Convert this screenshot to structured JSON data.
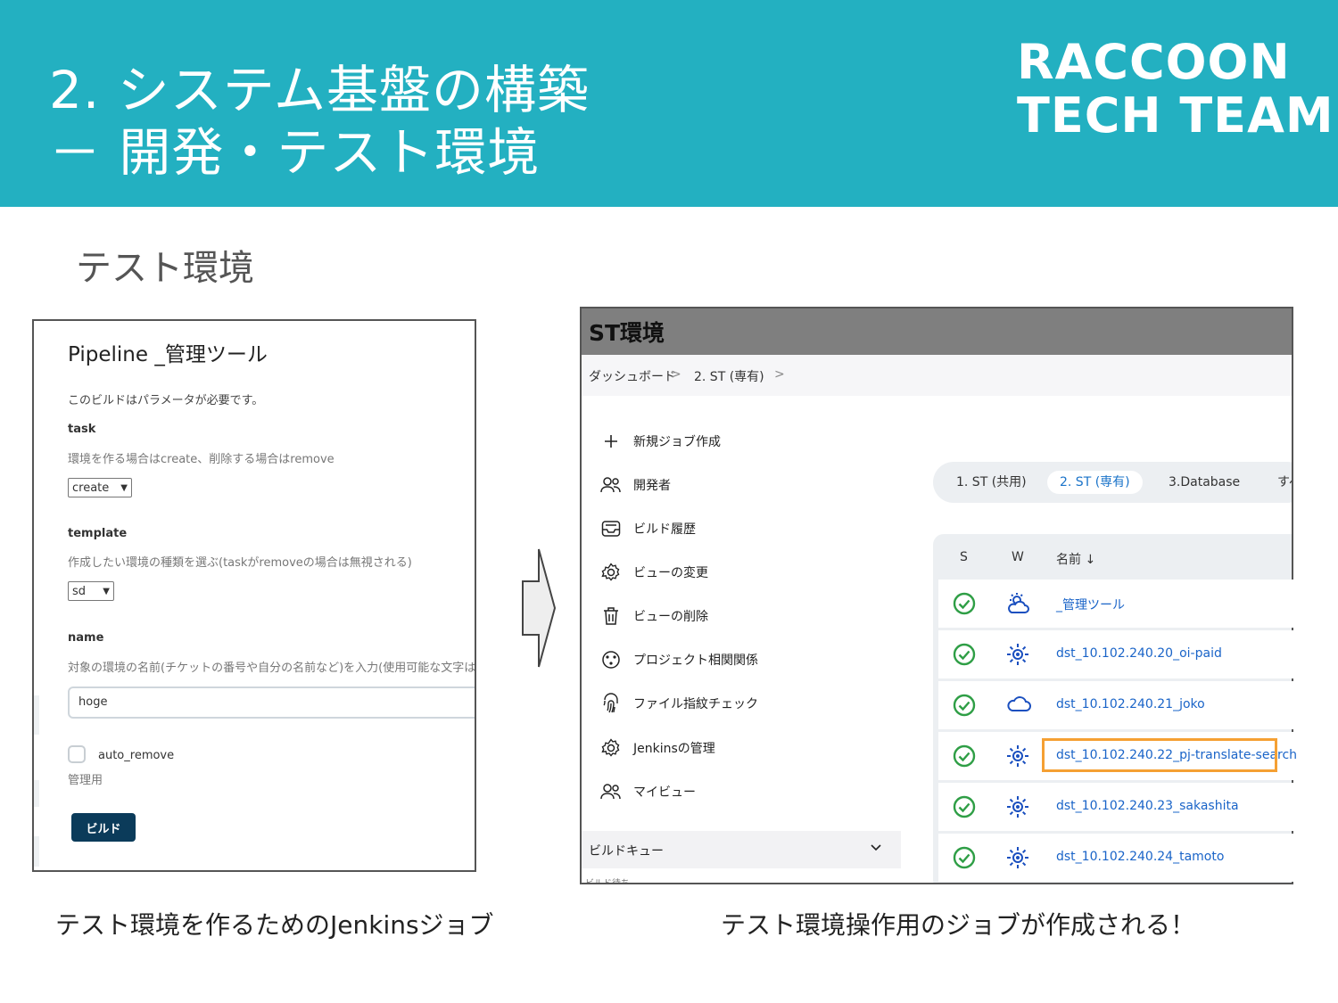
{
  "header": {
    "title_line1": "2. システム基盤の構築",
    "title_line2": "－ 開発・テスト環境",
    "brand_line1": "RACCOON",
    "brand_line2": "TECH TEAM"
  },
  "subtitle": "テスト環境",
  "left_panel": {
    "title": "Pipeline _管理ツール",
    "description": "このビルドはパラメータが必要です。",
    "task": {
      "label": "task",
      "help": "環境を作る場合はcreate、削除する場合はremove",
      "value": "create"
    },
    "template": {
      "label": "template",
      "help": "作成したい環境の種類を選ぶ(taskがremoveの場合は無視される)",
      "value": "sd"
    },
    "name": {
      "label": "name",
      "help": "対象の環境の名前(チケットの番号や自分の名前など)を入力(使用可能な文字は大文",
      "value": "hoge"
    },
    "auto_remove": {
      "label": "auto_remove",
      "help": "管理用"
    },
    "build_button": "ビルド"
  },
  "right_panel": {
    "header_title": "ST環境",
    "breadcrumb": [
      "ダッシュボード",
      "2. ST (専有)"
    ],
    "breadcrumb_sep": ">",
    "sidebar": [
      {
        "label": "新規ジョブ作成",
        "icon": "plus-icon"
      },
      {
        "label": "開発者",
        "icon": "people-icon"
      },
      {
        "label": "ビルド履歴",
        "icon": "inbox-icon"
      },
      {
        "label": "ビューの変更",
        "icon": "gear-icon"
      },
      {
        "label": "ビューの削除",
        "icon": "trash-icon"
      },
      {
        "label": "プロジェクト相関関係",
        "icon": "relation-icon"
      },
      {
        "label": "ファイル指紋チェック",
        "icon": "fingerprint-icon"
      },
      {
        "label": "Jenkinsの管理",
        "icon": "gear-icon"
      },
      {
        "label": "マイビュー",
        "icon": "people-icon"
      }
    ],
    "build_queue": "ビルドキュー",
    "build_queue_sub": "ビルド待ち",
    "tabs": [
      "1. ST (共用)",
      "2. ST (専有)",
      "3.Database",
      "すべ"
    ],
    "active_tab": 1,
    "table": {
      "headers": [
        "S",
        "W",
        "名前 ↓"
      ],
      "rows": [
        {
          "name": "_管理ツール",
          "status": "success",
          "weather": "partly-cloudy-icon"
        },
        {
          "name": "dst_10.102.240.20_oi-paid",
          "status": "success",
          "weather": "sunny-icon"
        },
        {
          "name": "dst_10.102.240.21_joko",
          "status": "success",
          "weather": "cloudy-icon"
        },
        {
          "name": "dst_10.102.240.22_pj-translate-search",
          "status": "success",
          "weather": "sunny-icon",
          "highlighted": true
        },
        {
          "name": "dst_10.102.240.23_sakashita",
          "status": "success",
          "weather": "sunny-icon"
        },
        {
          "name": "dst_10.102.240.24_tamoto",
          "status": "success",
          "weather": "sunny-icon"
        }
      ]
    },
    "colors": {
      "success": "#2e9e45",
      "link": "#1a64c8",
      "highlight": "#f5a033"
    }
  },
  "captions": {
    "left": "テスト環境を作るためのJenkinsジョブ",
    "right": "テスト環境操作用のジョブが作成される！"
  },
  "colors": {
    "header_bg": "#23b0c1"
  }
}
